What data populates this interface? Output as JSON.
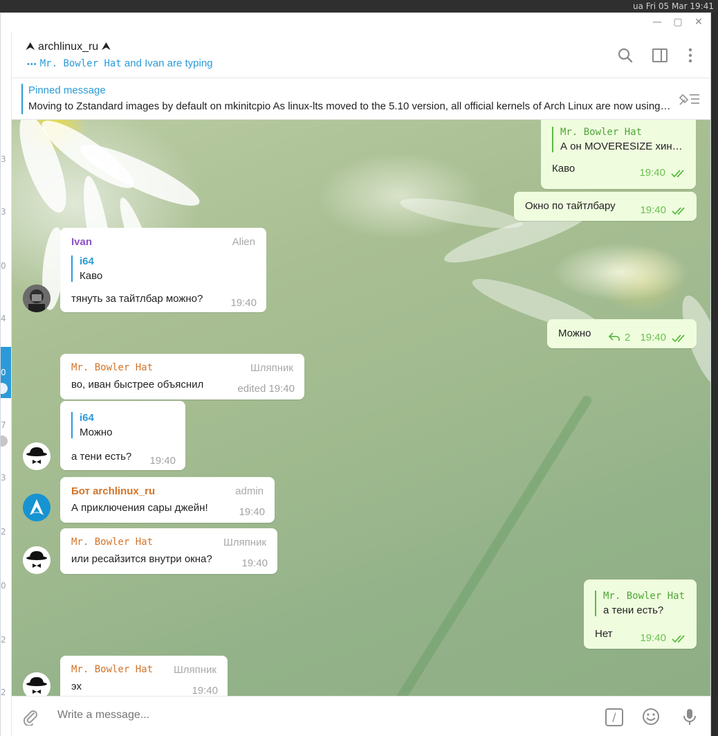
{
  "system": {
    "clock": "ua  Fri 05 Mar 19:41"
  },
  "left_strip": {
    "numbers": [
      "3",
      "3",
      "0",
      "4",
      "0",
      "7",
      "3",
      "2",
      "0",
      "2",
      "2"
    ]
  },
  "header": {
    "title": "⮝ archlinux_ru ⮝",
    "typing_dots": "•••",
    "typing_name": "Mr. Bowler Hat",
    "typing_rest": " and Ivan are typing"
  },
  "pinned": {
    "title": "Pinned message",
    "text": "Moving to Zstandard images by default on mkinitcpio  As linux-lts moved to the 5.10 version, all official kernels of Arch Linux are now using Zstandard compressed images by default"
  },
  "messages": {
    "m1": {
      "reply_name": "Mr. Bowler Hat",
      "reply_text": "А он MOVERESIZE хин…",
      "text": "Каво",
      "time": "19:40"
    },
    "m2": {
      "text": "Окно по тайтлбару",
      "time": "19:40"
    },
    "m3": {
      "name": "Ivan",
      "role": "Alien",
      "reply_name": "i64",
      "reply_text": "Каво",
      "text": "тянуть за тайтлбар можно?",
      "time": "19:40"
    },
    "m4": {
      "text": "Можно",
      "replies": "2",
      "time": "19:40"
    },
    "m5": {
      "name": "Mr. Bowler Hat",
      "role": "Шляпник",
      "text": "во, иван быстрее объяснил",
      "time": "edited 19:40"
    },
    "m6": {
      "reply_name": "i64",
      "reply_text": "Можно",
      "text": "а тени есть?",
      "time": "19:40"
    },
    "m7": {
      "name": "Бот archlinux_ru",
      "role": "admin",
      "text": "А приключения сары джейн!",
      "time": "19:40"
    },
    "m8": {
      "name": "Mr. Bowler Hat",
      "role": "Шляпник",
      "text": "или ресайзится внутри окна?",
      "time": "19:40"
    },
    "m9": {
      "reply_name": "Mr. Bowler Hat",
      "reply_text": "а тени есть?",
      "text": "Нет",
      "time": "19:40"
    },
    "m10": {
      "name": "Mr. Bowler Hat",
      "role": "Шляпник",
      "text": "эх",
      "time": "19:40"
    }
  },
  "composer": {
    "placeholder": "Write a message...",
    "command_glyph": "/"
  },
  "colors": {
    "accent": "#2a9bd8",
    "outgoing_bg": "#effdde",
    "outgoing_time": "#6cbf52",
    "ivan_name": "#8e54c7",
    "bowler_name": "#d2742a",
    "bot_name": "#d2742a"
  },
  "icons": [
    "search-icon",
    "sidebar-toggle-icon",
    "more-vert-icon",
    "unpin-icon",
    "attach-icon",
    "emoji-icon",
    "mic-icon",
    "reply-arrow-icon",
    "double-check-icon",
    "minimize-icon",
    "maximize-icon",
    "close-icon"
  ]
}
